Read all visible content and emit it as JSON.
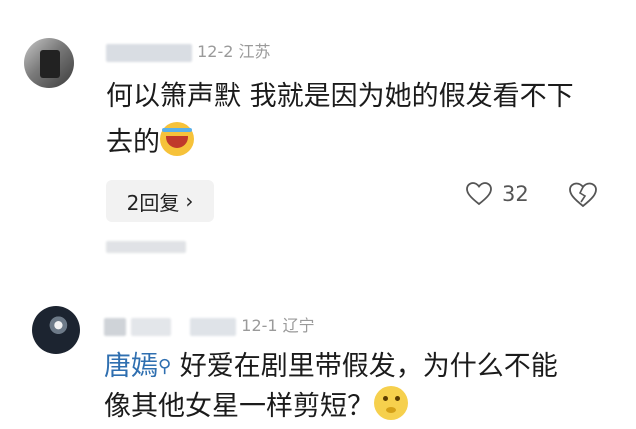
{
  "comment1": {
    "meta": "12-2 江苏",
    "text_line1": "何以箫声默 我就是因为她的假发看不下",
    "text_line2": "去的",
    "emoji": "laughing-crying-emoji",
    "reply_button": "2回复",
    "reply_chevron": "›",
    "like_count": "32"
  },
  "comment2": {
    "meta": "12-1 辽宁",
    "mention": "唐嫣",
    "mention_icon": "search-icon",
    "text_line1": "好爱在剧里带假发，为什么不能",
    "text_line2": "像其他女星一样剪短？",
    "emoji": "thinking-emoji"
  }
}
